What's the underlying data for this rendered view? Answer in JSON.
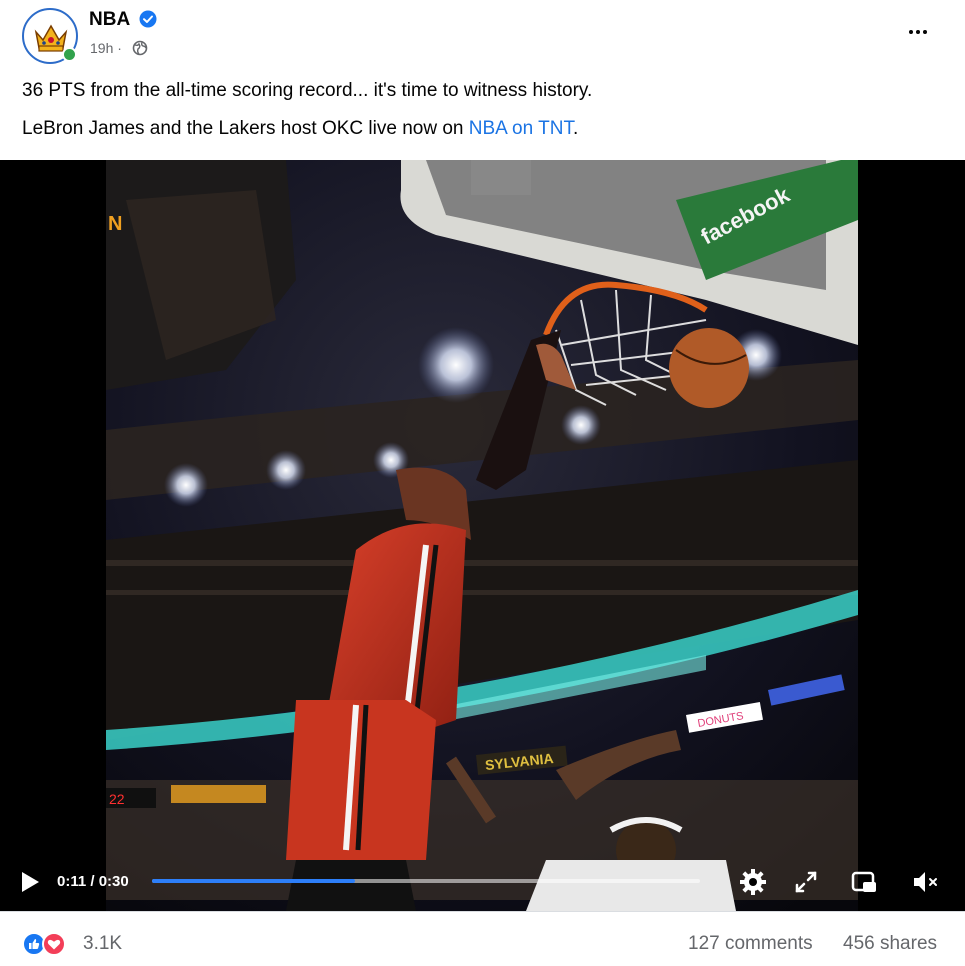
{
  "post": {
    "page_name": "NBA",
    "verified_icon": "verified-badge-icon",
    "time": "19h ·",
    "audience_icon": "globe-icon",
    "more_icon": "more-options-icon"
  },
  "caption": {
    "line1": "36 PTS from the all-time scoring record... it's time to witness history.",
    "line2_prefix": "LeBron James and the Lakers host OKC live now on ",
    "line2_link": "NBA on TNT",
    "line2_suffix": "."
  },
  "video": {
    "scene_text": {
      "backboard_sign": "facebook",
      "arena_sign_1": "SYLVANIA",
      "arena_sign_2": "DONUTS",
      "scoreboard": "22"
    },
    "controls": {
      "time": "0:11 / 0:30",
      "progress": 0.37,
      "play_icon": "play-icon",
      "settings_icon": "gear-icon",
      "fullscreen_icon": "fullscreen-icon",
      "pip_icon": "picture-in-picture-icon",
      "mute_icon": "muted-speaker-icon"
    }
  },
  "footer": {
    "reaction_count": "3.1K",
    "comments": "127 comments",
    "shares": "456 shares"
  },
  "colors": {
    "link": "#1b74e4",
    "progress": "#2d7ff9",
    "like": "#1877f2",
    "love": "#f33e58",
    "online": "#31a24c"
  }
}
